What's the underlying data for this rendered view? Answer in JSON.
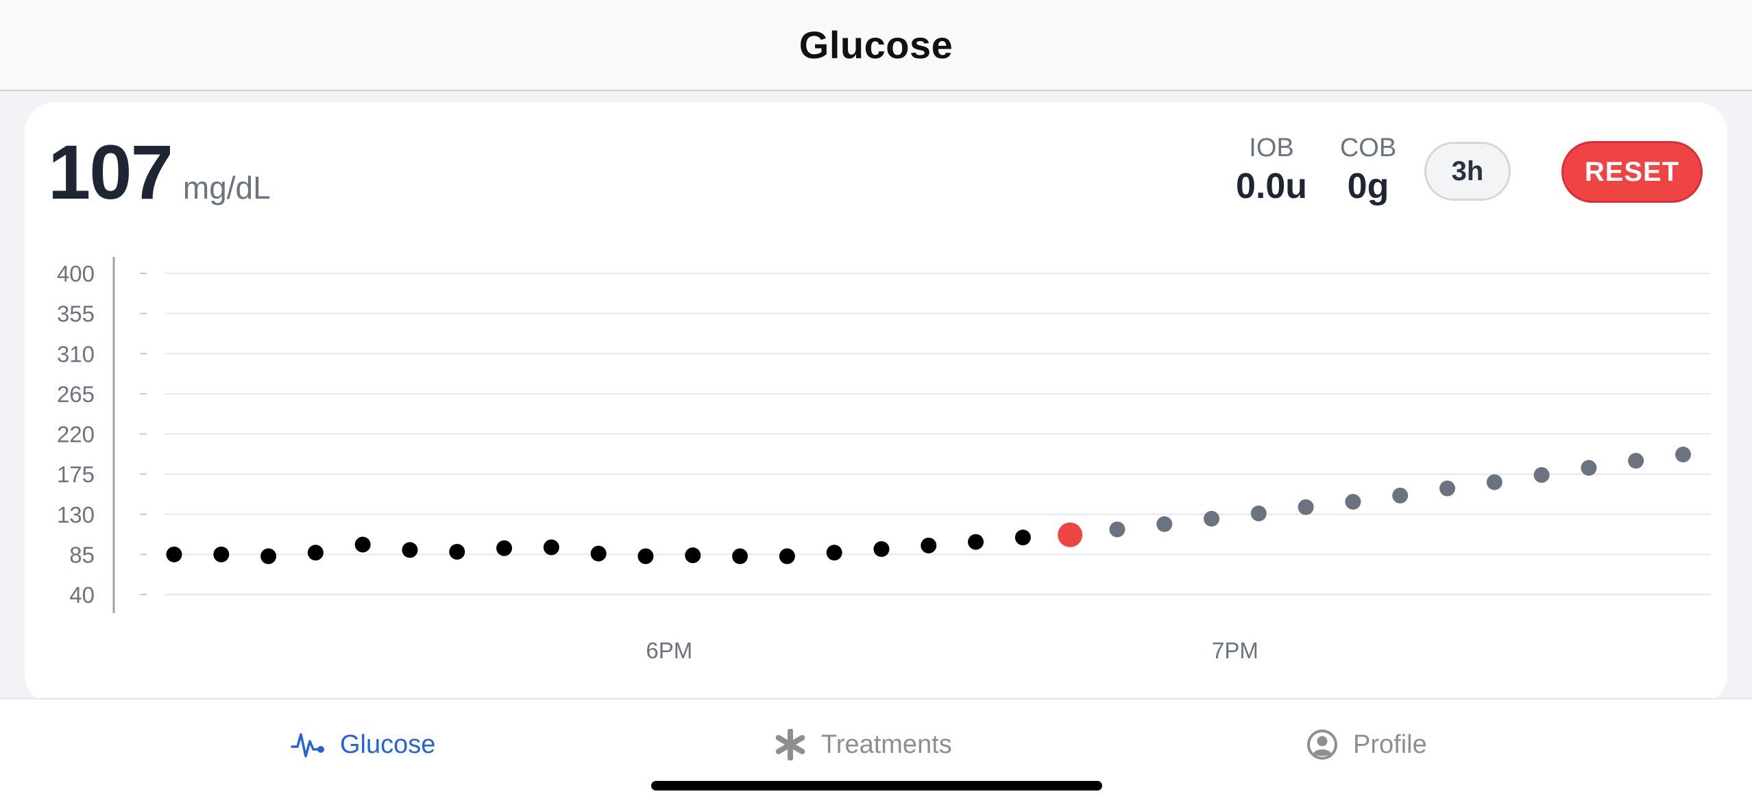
{
  "header": {
    "title": "Glucose"
  },
  "reading": {
    "value": "107",
    "unit": "mg/dL"
  },
  "stats": {
    "iob": {
      "label": "IOB",
      "value": "0.0u"
    },
    "cob": {
      "label": "COB",
      "value": "0g"
    }
  },
  "controls": {
    "range_label": "3h",
    "reset_label": "RESET"
  },
  "colors": {
    "history": "#000000",
    "current": "#ef4444",
    "forecast": "#6b7280",
    "grid": "#e5e7eb",
    "accent": "#2563d6"
  },
  "chart_data": {
    "type": "scatter",
    "ylim": [
      40,
      400
    ],
    "yticks": [
      400,
      355,
      310,
      265,
      220,
      175,
      130,
      85,
      40
    ],
    "x_tick_labels": [
      {
        "label": "6PM",
        "minutes": 0
      },
      {
        "label": "7PM",
        "minutes": 60
      }
    ],
    "xlim_minutes": [
      -52.5,
      109.5
    ],
    "series": [
      {
        "role": "history",
        "points": [
          {
            "t": -52.5,
            "v": 85
          },
          {
            "t": -47.5,
            "v": 85
          },
          {
            "t": -42.5,
            "v": 83
          },
          {
            "t": -37.5,
            "v": 87
          },
          {
            "t": -32.5,
            "v": 96
          },
          {
            "t": -27.5,
            "v": 90
          },
          {
            "t": -22.5,
            "v": 88
          },
          {
            "t": -17.5,
            "v": 92
          },
          {
            "t": -12.5,
            "v": 93
          },
          {
            "t": -7.5,
            "v": 86
          },
          {
            "t": -2.5,
            "v": 83
          },
          {
            "t": 2.5,
            "v": 84
          },
          {
            "t": 7.5,
            "v": 83
          },
          {
            "t": 12.5,
            "v": 83
          },
          {
            "t": 17.5,
            "v": 87
          },
          {
            "t": 22.5,
            "v": 91
          },
          {
            "t": 27.5,
            "v": 95
          },
          {
            "t": 32.5,
            "v": 99
          },
          {
            "t": 37.5,
            "v": 104
          }
        ]
      },
      {
        "role": "current",
        "points": [
          {
            "t": 42.5,
            "v": 107
          }
        ]
      },
      {
        "role": "forecast",
        "points": [
          {
            "t": 47.5,
            "v": 113
          },
          {
            "t": 52.5,
            "v": 119
          },
          {
            "t": 57.5,
            "v": 125
          },
          {
            "t": 62.5,
            "v": 131
          },
          {
            "t": 67.5,
            "v": 138
          },
          {
            "t": 72.5,
            "v": 144
          },
          {
            "t": 77.5,
            "v": 151
          },
          {
            "t": 82.5,
            "v": 159
          },
          {
            "t": 87.5,
            "v": 166
          },
          {
            "t": 92.5,
            "v": 174
          },
          {
            "t": 97.5,
            "v": 182
          },
          {
            "t": 102.5,
            "v": 190
          },
          {
            "t": 107.5,
            "v": 197
          }
        ]
      }
    ]
  },
  "tabs": [
    {
      "label": "Glucose",
      "active": true
    },
    {
      "label": "Treatments",
      "active": false
    },
    {
      "label": "Profile",
      "active": false
    }
  ]
}
